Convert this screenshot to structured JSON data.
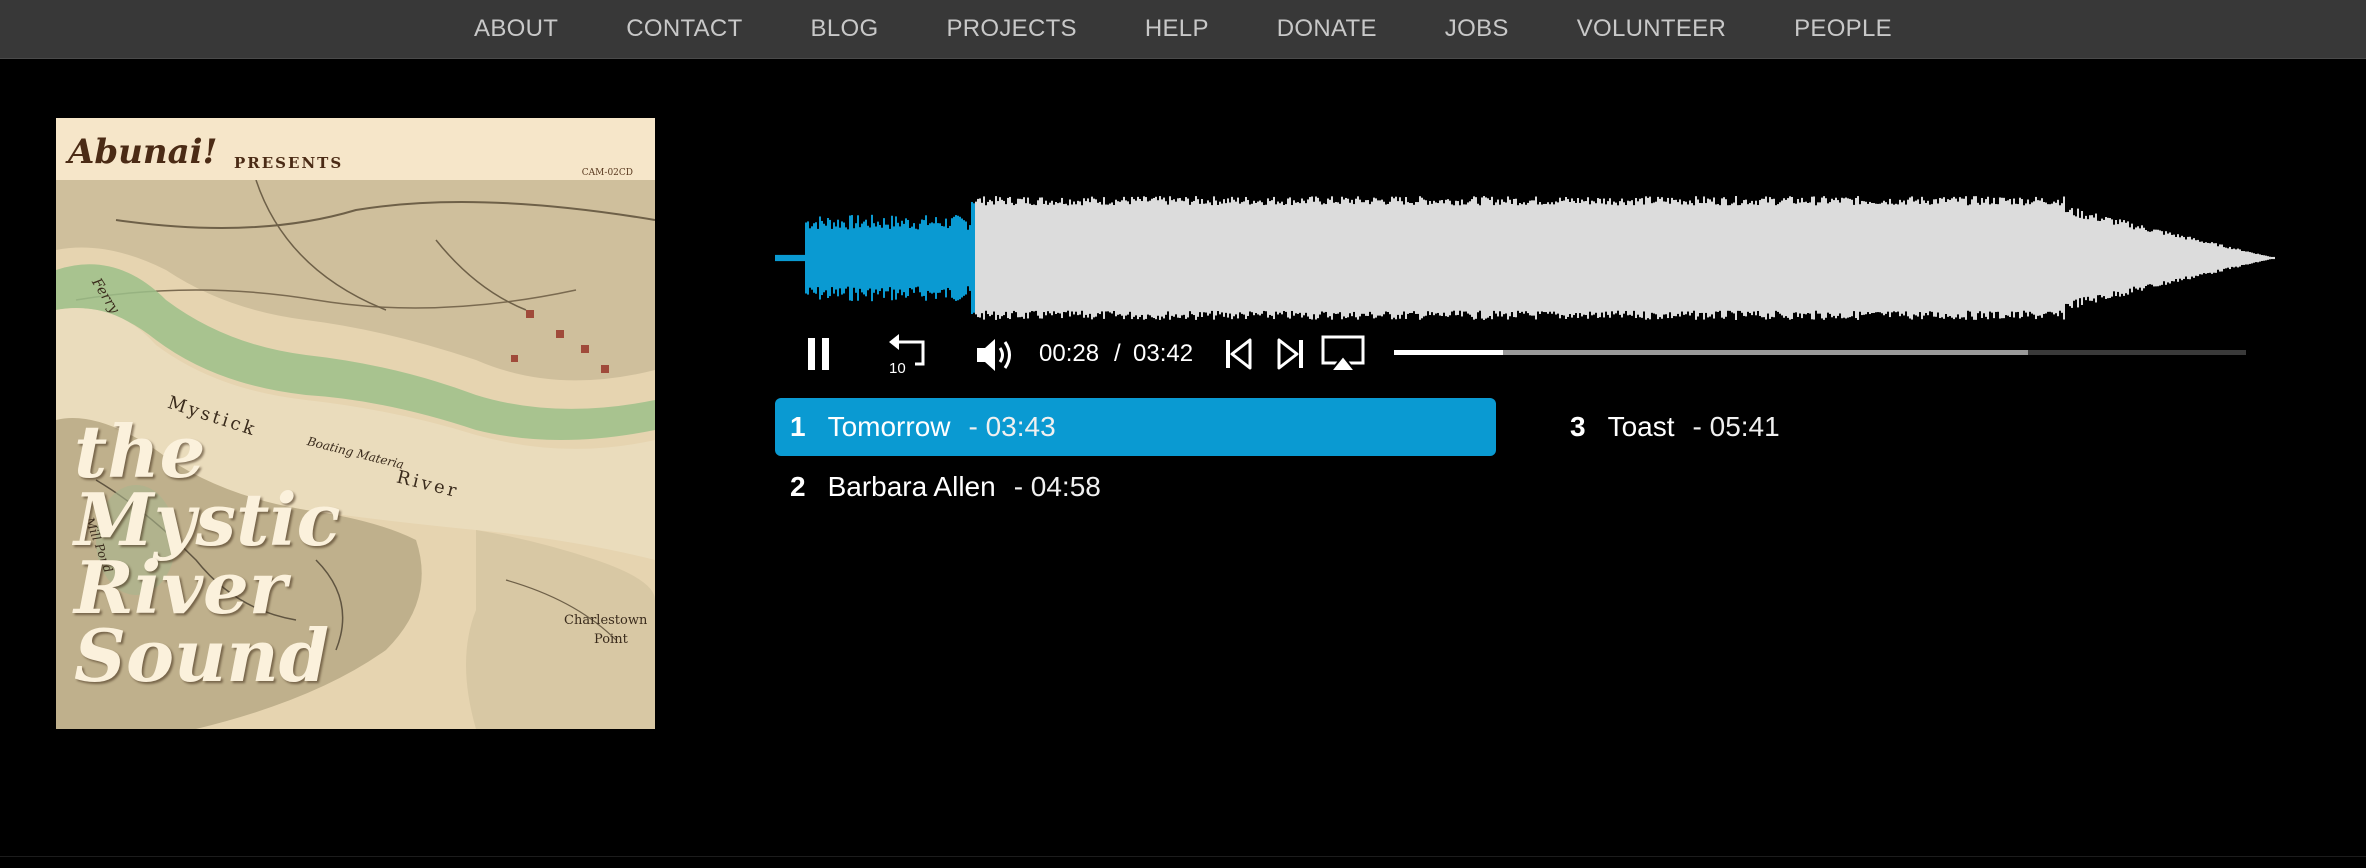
{
  "nav": {
    "items": [
      "ABOUT",
      "CONTACT",
      "BLOG",
      "PROJECTS",
      "HELP",
      "DONATE",
      "JOBS",
      "VOLUNTEER",
      "PEOPLE"
    ]
  },
  "album": {
    "brand": "Abunai!",
    "presents": "PRESENTS",
    "catalog": "CAM-02CD",
    "title": "the\nMystic\nRiver\nSound",
    "map_labels": [
      "Ferry",
      "Mystick",
      "Boating Materia",
      "River",
      "Mill Pond",
      "Charlestown",
      "Point"
    ]
  },
  "player": {
    "current_time": "00:28",
    "separator": "/",
    "duration": "03:42",
    "played_fraction": 0.128,
    "buffered_fraction": 0.744,
    "rewind_label": "10",
    "colors": {
      "played": "#0a9ad2",
      "unplayed": "#dcdcdc",
      "active_track": "#0a9ad2"
    },
    "icons": [
      "pause-icon",
      "rewind-10-icon",
      "volume-icon",
      "previous-track-icon",
      "next-track-icon",
      "airplay-icon"
    ]
  },
  "tracks": [
    {
      "num": "1",
      "title": "Tomorrow",
      "duration": "- 03:43",
      "active": true
    },
    {
      "num": "2",
      "title": "Barbara Allen",
      "duration": "- 04:58",
      "active": false
    },
    {
      "num": "3",
      "title": "Toast",
      "duration": "- 05:41",
      "active": false
    }
  ]
}
